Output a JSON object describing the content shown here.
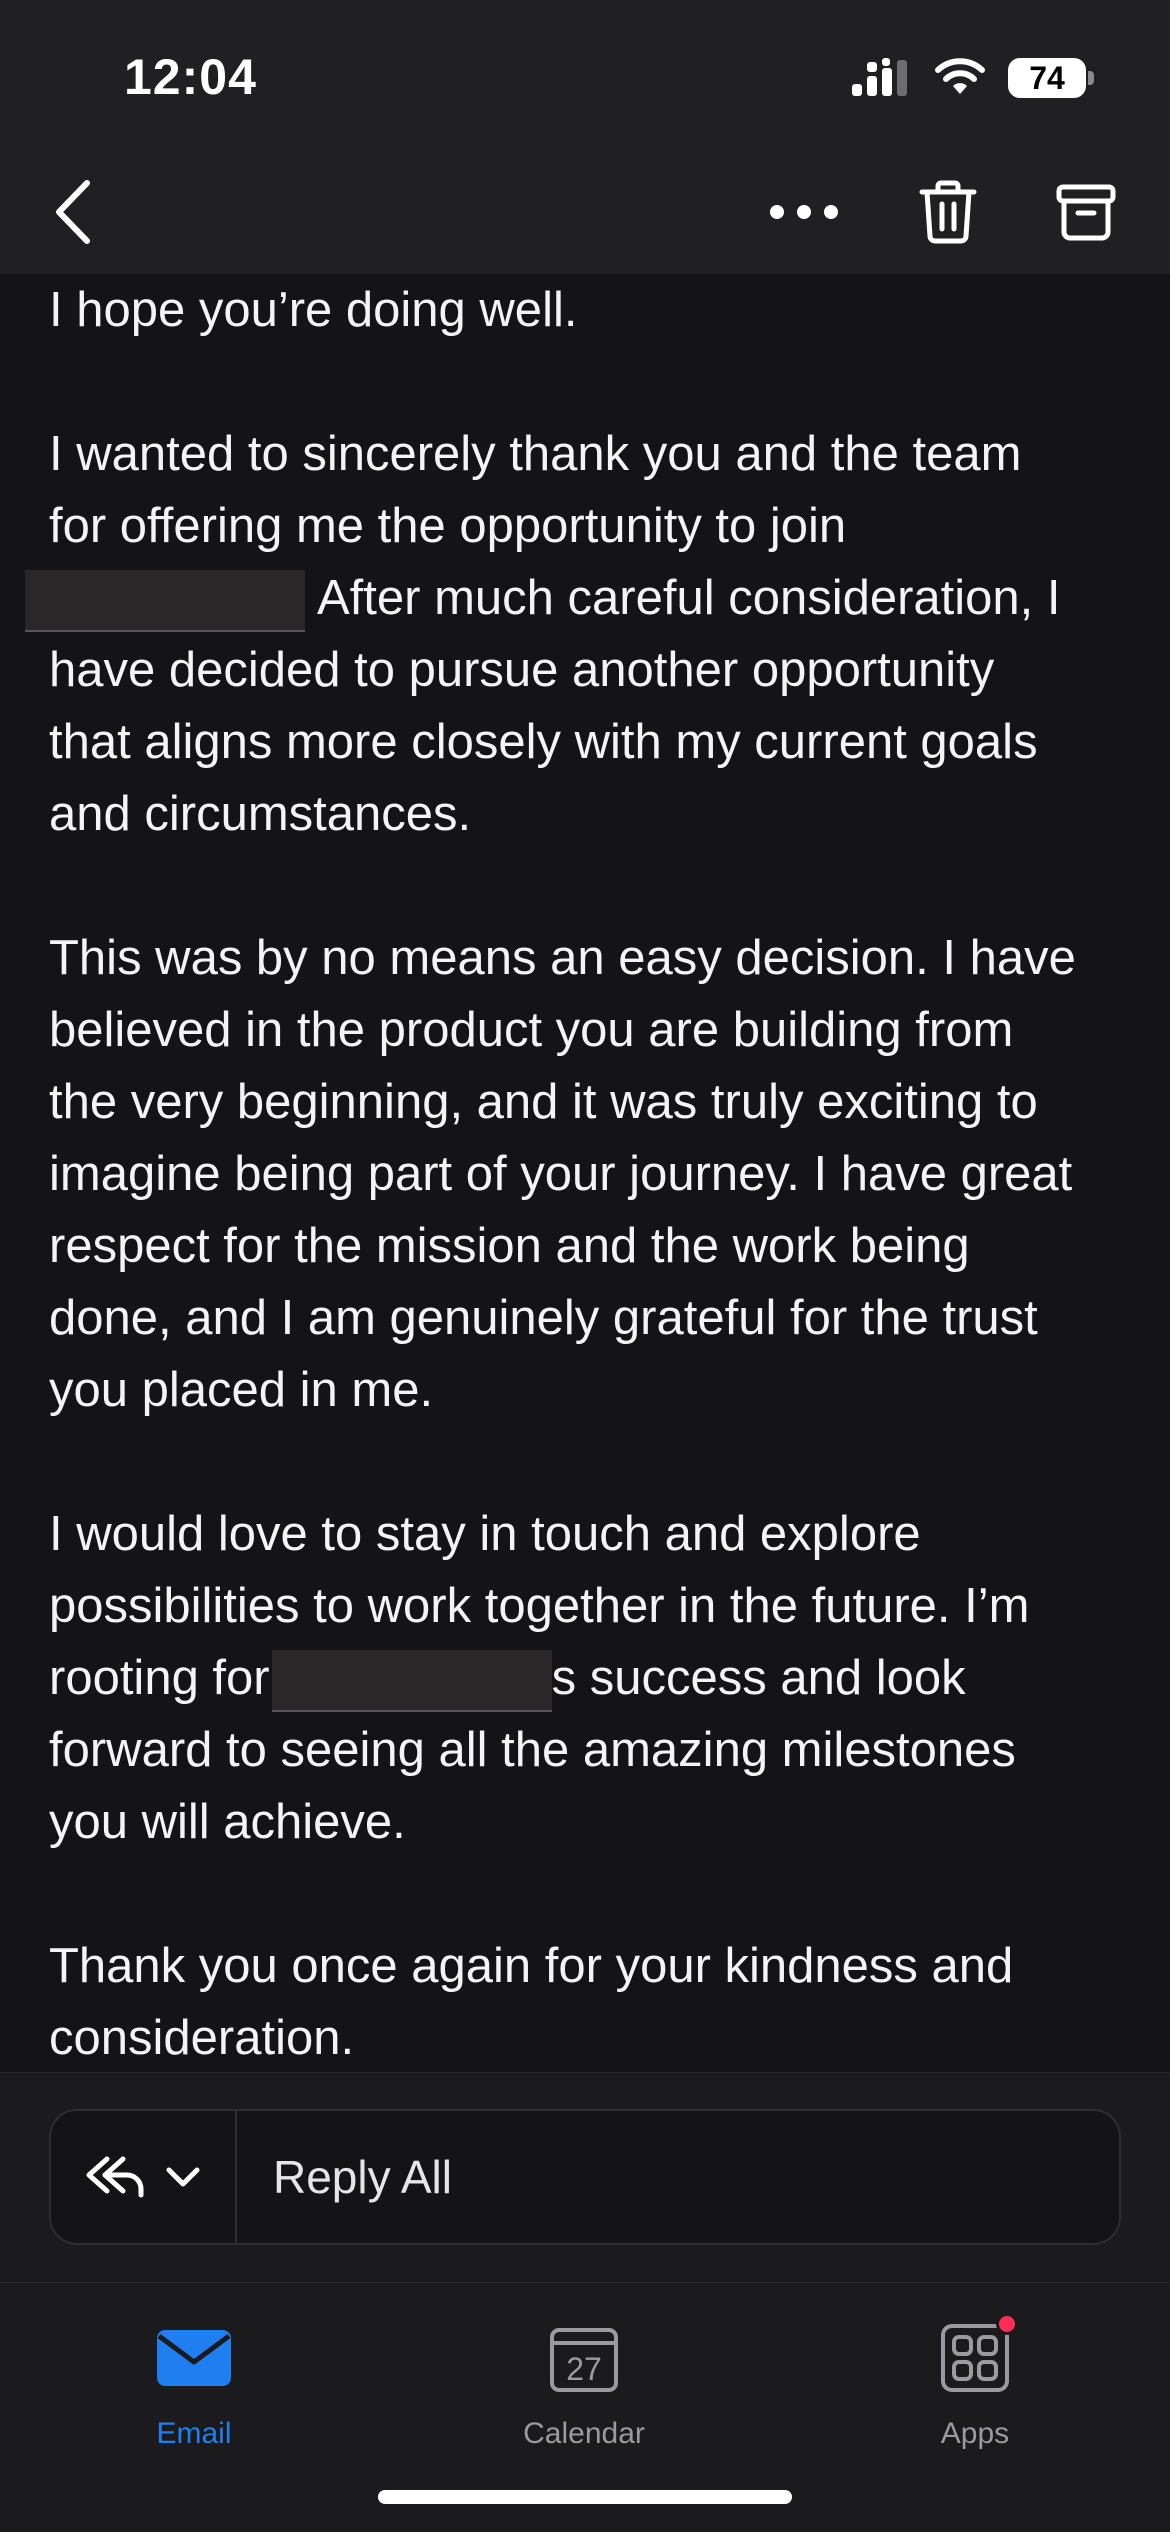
{
  "status_bar": {
    "time": "12:04",
    "battery": "74"
  },
  "toolbar": {
    "back_icon": "chevron-left-icon",
    "more_icon": "more-horizontal-icon",
    "delete_icon": "trash-icon",
    "archive_icon": "archive-icon"
  },
  "email": {
    "paragraphs": [
      {
        "lines": [
          [
            "I hope you’re doing well."
          ]
        ]
      },
      {
        "lines": [
          [
            "I wanted to sincerely thank you and the team"
          ],
          [
            "for offering me the opportunity to join"
          ],
          [
            "",
            "After much careful consideration, I"
          ],
          [
            "have decided to pursue another opportunity"
          ],
          [
            "that aligns more closely with my current goals"
          ],
          [
            "and circumstances."
          ]
        ]
      },
      {
        "lines": [
          [
            "This was by no means an easy decision. I have"
          ],
          [
            "believed in the product you are building from"
          ],
          [
            "the very beginning, and it was truly exciting to"
          ],
          [
            "imagine being part of your journey. I have great"
          ],
          [
            "respect for the mission and the work being"
          ],
          [
            "done, and I am genuinely grateful for the trust"
          ],
          [
            "you placed in me."
          ]
        ]
      },
      {
        "lines": [
          [
            "I would love to stay in touch and explore"
          ],
          [
            "possibilities to work together in the future. I’m"
          ],
          [
            "rooting for",
            "s success and look"
          ],
          [
            "forward to seeing all the amazing milestones"
          ],
          [
            "you will achieve."
          ]
        ]
      },
      {
        "lines": [
          [
            "Thank you once again for your kindness and"
          ],
          [
            "consideration."
          ]
        ]
      }
    ]
  },
  "reply": {
    "label": "Reply All",
    "icon": "reply-all-icon",
    "chevron_icon": "chevron-down-icon"
  },
  "tabs": [
    {
      "label": "Email",
      "icon": "mail-icon",
      "active": true
    },
    {
      "label": "Calendar",
      "icon": "calendar-icon",
      "day": "27",
      "active": false
    },
    {
      "label": "Apps",
      "icon": "apps-grid-icon",
      "active": false
    }
  ],
  "colors": {
    "accent": "#1f7ff0",
    "badge": "#ff2d55",
    "background": "#141416"
  }
}
